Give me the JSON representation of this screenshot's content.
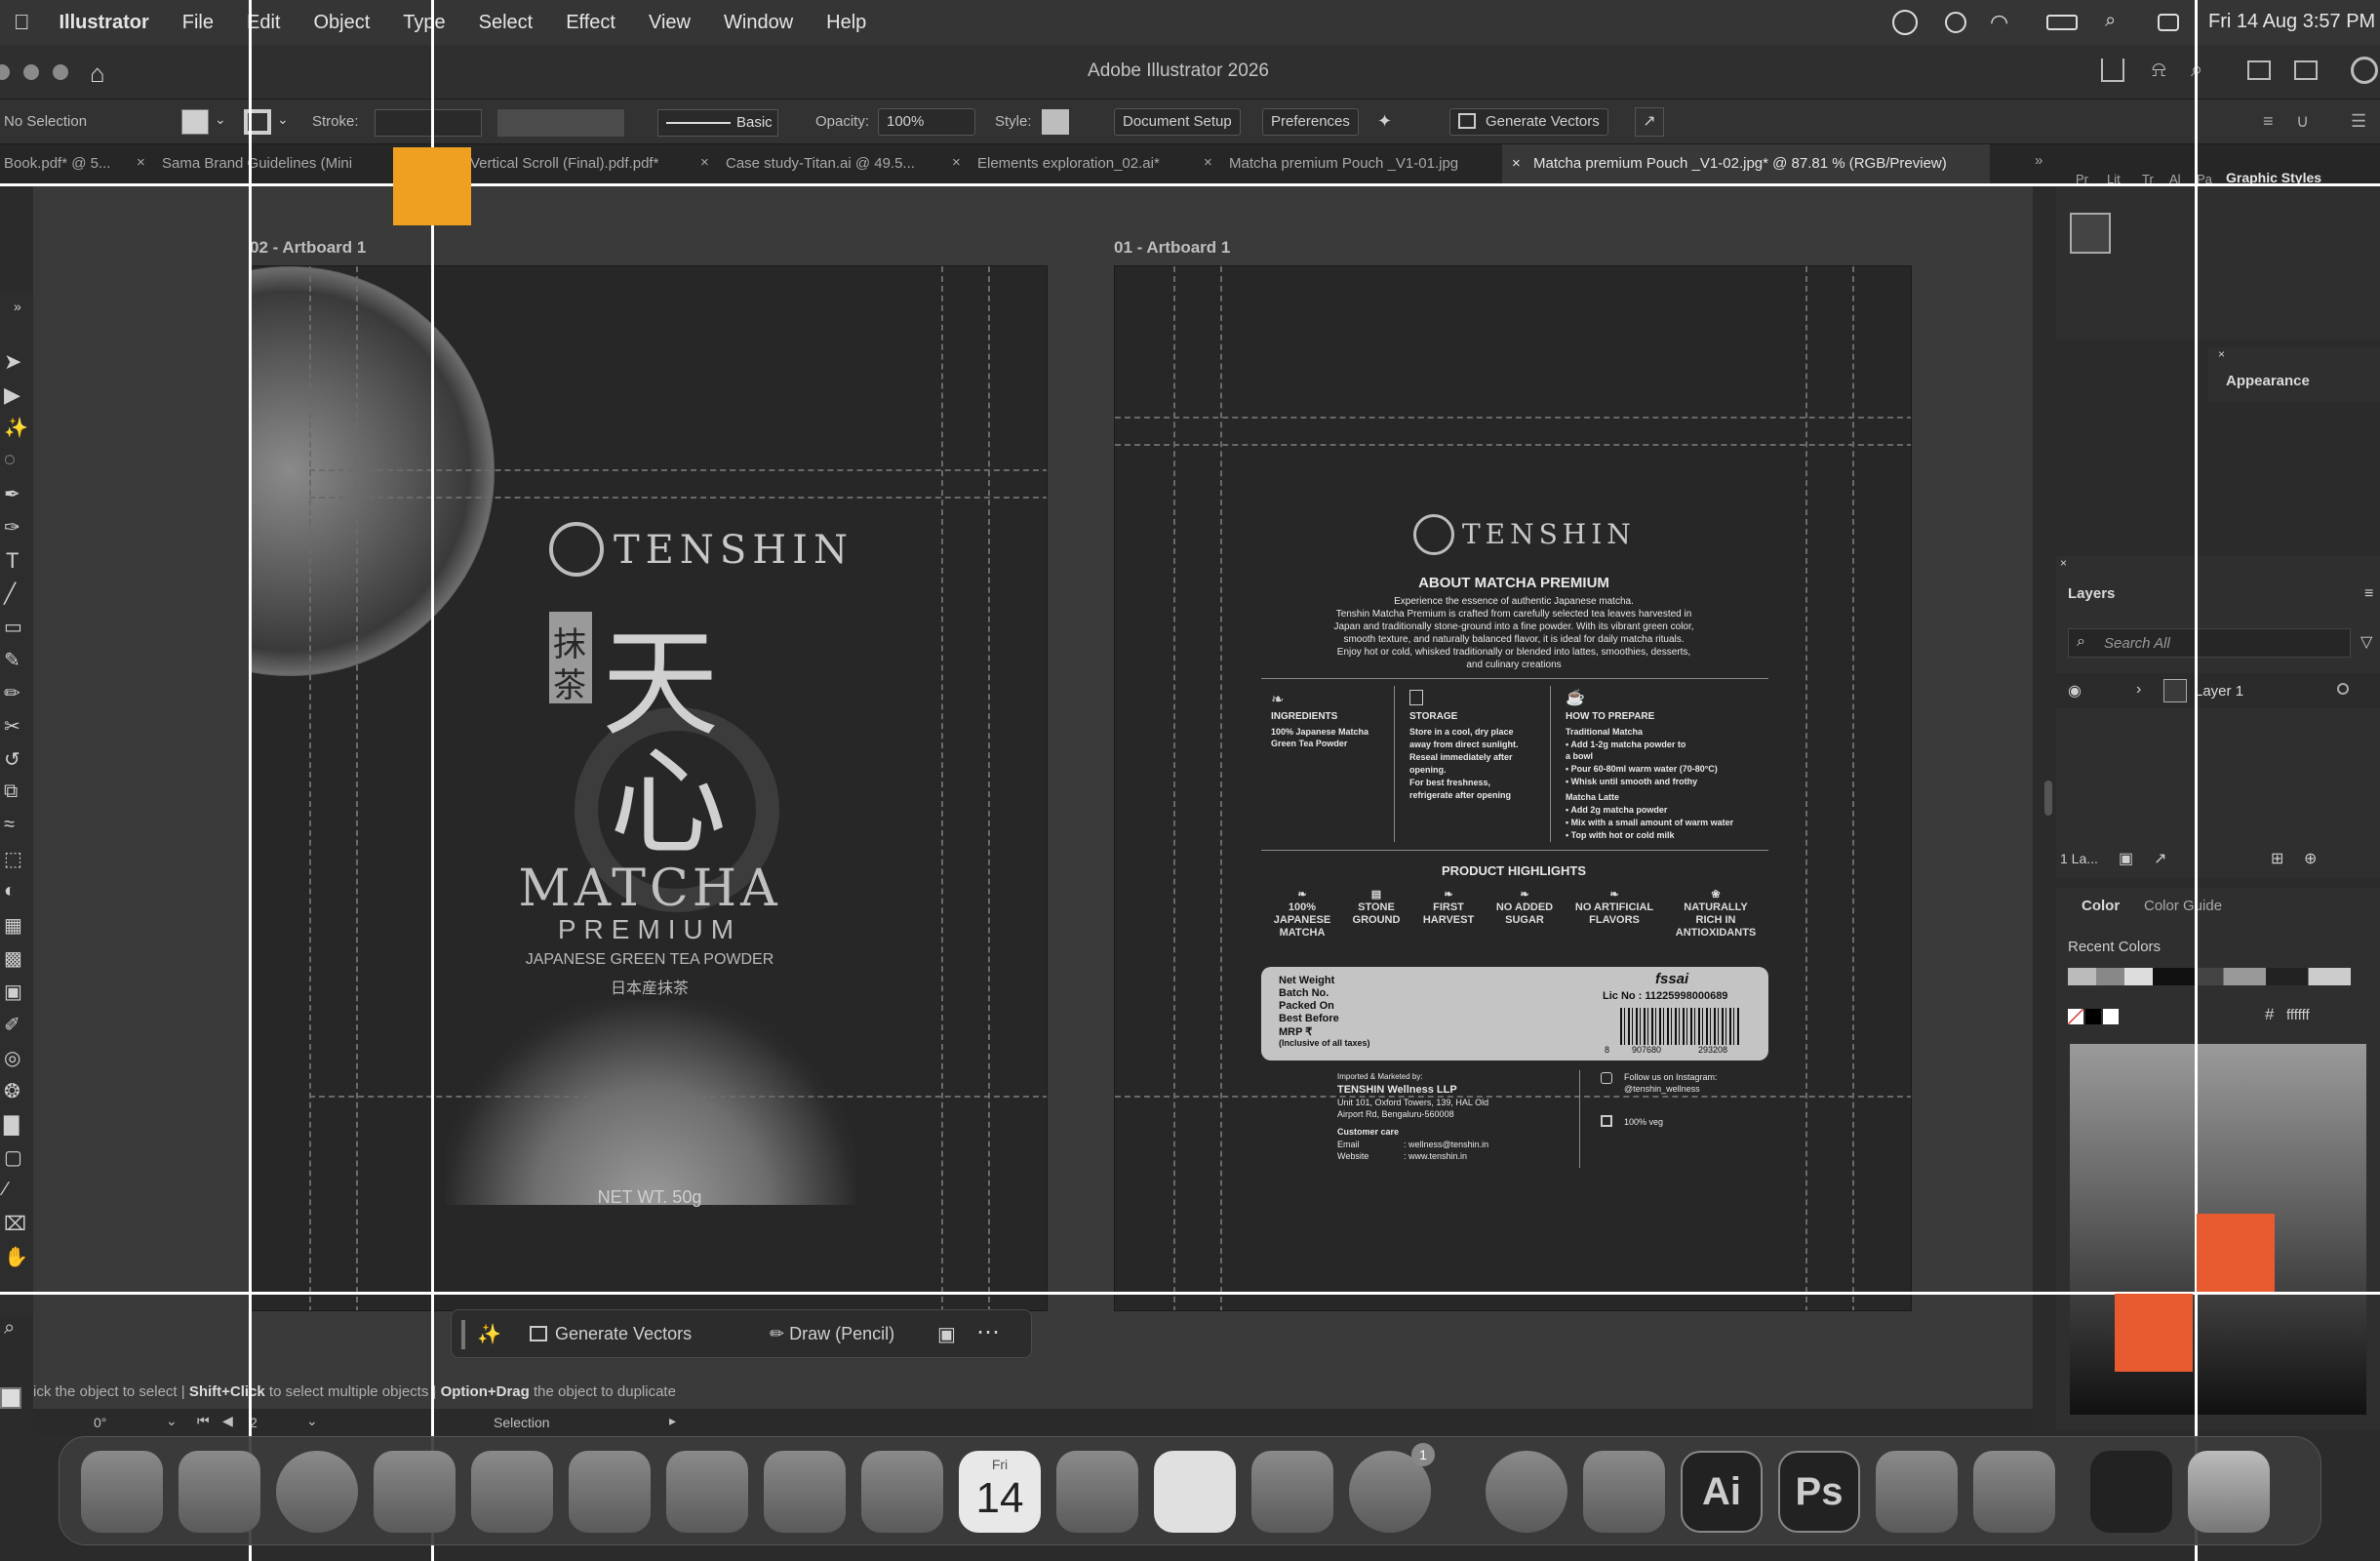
{
  "menubar": {
    "app": "Illustrator",
    "items": [
      "File",
      "Edit",
      "Object",
      "Type",
      "Select",
      "Effect",
      "View",
      "Window",
      "Help"
    ],
    "datetime": "Fri 14 Aug  3:57 PM"
  },
  "window": {
    "title": "Adobe Illustrator 2026"
  },
  "control": {
    "selection": "No Selection",
    "stroke_label": "Stroke:",
    "brush": "Basic",
    "opacity_label": "Opacity:",
    "opacity_value": "100%",
    "style_label": "Style:",
    "document_setup": "Document Setup",
    "preferences": "Preferences",
    "generate_vectors": "Generate Vectors"
  },
  "tabs": [
    "Book.pdf* @ 5...",
    "Sama Brand Guidelines  (Mini",
    "Vertical Scroll (Final).pdf.pdf*",
    "Case study-Titan.ai @ 49.5...",
    "Elements exploration_02.ai*",
    "Matcha premium  Pouch _V1-01.jpg",
    "Matcha premium  Pouch _V1-02.jpg* @ 87.81 % (RGB/Preview)"
  ],
  "right_tabs": {
    "short": [
      "Pr",
      "Lit",
      "Tr",
      "Al",
      "Pa"
    ],
    "graphic_styles": "Graphic Styles"
  },
  "artboards": {
    "front_label": "02 - Artboard 1",
    "back_label": "01 - Artboard 1"
  },
  "front": {
    "brand": "TENSHIN",
    "kanji_big": [
      "天",
      "心"
    ],
    "kanji_side": [
      "抹",
      "茶"
    ],
    "product": "MATCHA",
    "sub": "PREMIUM",
    "desc": "JAPANESE GREEN TEA POWDER",
    "desc_jp": "日本産抹茶",
    "net": "NET WT. 50g"
  },
  "back": {
    "brand": "TENSHIN",
    "about_title": "ABOUT MATCHA PREMIUM",
    "about_lines": [
      "Experience the essence of authentic Japanese matcha.",
      "Tenshin Matcha Premium is crafted from carefully selected tea leaves harvested in",
      "Japan and traditionally stone-ground into a fine powder. With its vibrant green color,",
      "smooth texture, and naturally balanced flavor, it is ideal for daily matcha rituals.",
      "Enjoy hot or cold, whisked traditionally or blended into lattes, smoothies, desserts,",
      "and culinary creations"
    ],
    "ingredients_title": "INGREDIENTS",
    "ingredients_lines": [
      "100% Japanese Matcha",
      "Green Tea Powder"
    ],
    "storage_title": "STORAGE",
    "storage_lines": [
      "Store in a cool, dry place",
      "away from direct sunlight.",
      "Reseal immediately after",
      "opening.",
      "For best freshness,",
      "refrigerate after opening"
    ],
    "prepare_title": "HOW TO PREPARE",
    "prepare_lines": [
      "Traditional Matcha",
      "•  Add 1-2g matcha powder to",
      "    a bowl",
      "•  Pour 60-80ml warm water (70-80°C)",
      "•  Whisk until smooth and frothy",
      "Matcha Latte",
      "•  Add 2g matcha powder",
      "•  Mix with a small amount of warm water",
      "•  Top with hot or cold milk"
    ],
    "highlights_title": "PRODUCT HIGHLIGHTS",
    "highlights": [
      [
        "100%",
        "JAPANESE",
        "MATCHA"
      ],
      [
        "STONE",
        "GROUND"
      ],
      [
        "FIRST",
        "HARVEST"
      ],
      [
        "NO ADDED",
        "SUGAR"
      ],
      [
        "NO ARTIFICIAL",
        "FLAVORS"
      ],
      [
        "NATURALLY",
        "RICH IN",
        "ANTIOXIDANTS"
      ]
    ],
    "label_fields": [
      "Net Weight",
      "Batch No.",
      "Packed On",
      "Best Before",
      "MRP ₹",
      "(Inclusive of all taxes)"
    ],
    "fssai": "fssai",
    "lic": "Lic No : 11225998000689",
    "barcode_left": "8",
    "barcode_mid": "907680",
    "barcode_right": "293208",
    "imported": "Imported & Marketed by:",
    "company": "TENSHIN Wellness LLP",
    "address": [
      "Unit 101, Oxford Towers, 139, HAL Old",
      "Airport Rd, Bengaluru-560008"
    ],
    "customer_care": "Customer care",
    "email_label": "Email",
    "email": ": wellness@tenshin.in",
    "website_label": "Website",
    "website": ": www.tenshin.in",
    "instagram": [
      "Follow us on Instagram:",
      "@tenshin_wellness"
    ],
    "veg": "100% veg"
  },
  "panels": {
    "appearance": "Appearance",
    "layers": "Layers",
    "search": "Search All",
    "layer1": "Layer 1",
    "layers_count": "1 La...",
    "color": "Color",
    "color_guide": "Color Guide",
    "recent": "Recent Colors",
    "hex": "ffffff",
    "hash": "#"
  },
  "floating": {
    "generate": "Generate Vectors",
    "draw": "Draw (Pencil)"
  },
  "status": {
    "hint_parts": [
      "ick the object to select  |  ",
      "Shift+Click",
      " to select multiple objects  |  ",
      "Option+Drag",
      " the object to duplicate"
    ],
    "angle": "0°",
    "page": "2",
    "mode": "Selection"
  },
  "dock": {
    "calendar_day": "Fri",
    "calendar_date": "14",
    "badge": "1",
    "ai": "Ai",
    "ps": "Ps"
  },
  "colors": {
    "orange": "#f0a020",
    "red": "#e85a30"
  }
}
